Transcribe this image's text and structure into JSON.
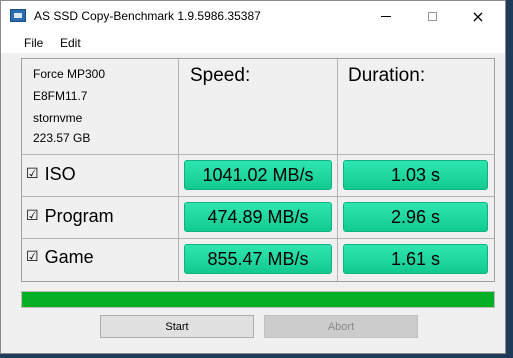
{
  "window": {
    "title": "AS SSD Copy-Benchmark 1.9.5986.35387",
    "controls": {
      "minimize": "minimize",
      "maximize": "maximize",
      "close": "×"
    }
  },
  "menu": {
    "file": "File",
    "edit": "Edit"
  },
  "drive": {
    "model": "Force MP300",
    "firmware": "E8FM11.7",
    "driver": "stornvme",
    "size": "223.57 GB"
  },
  "headers": {
    "speed": "Speed:",
    "duration": "Duration:"
  },
  "rows": [
    {
      "checkbox": "☑",
      "label": "ISO",
      "speed": "1041.02 MB/s",
      "duration": "1.03 s"
    },
    {
      "checkbox": "☑",
      "label": "Program",
      "speed": "474.89 MB/s",
      "duration": "2.96 s"
    },
    {
      "checkbox": "☑",
      "label": "Game",
      "speed": "855.47 MB/s",
      "duration": "1.61 s"
    }
  ],
  "progress": {
    "percent": 100,
    "color": "#06b025"
  },
  "buttons": {
    "start": "Start",
    "abort": "Abort"
  },
  "colors": {
    "result_fill": "#1fd9a2",
    "result_border": "#0fb382"
  }
}
